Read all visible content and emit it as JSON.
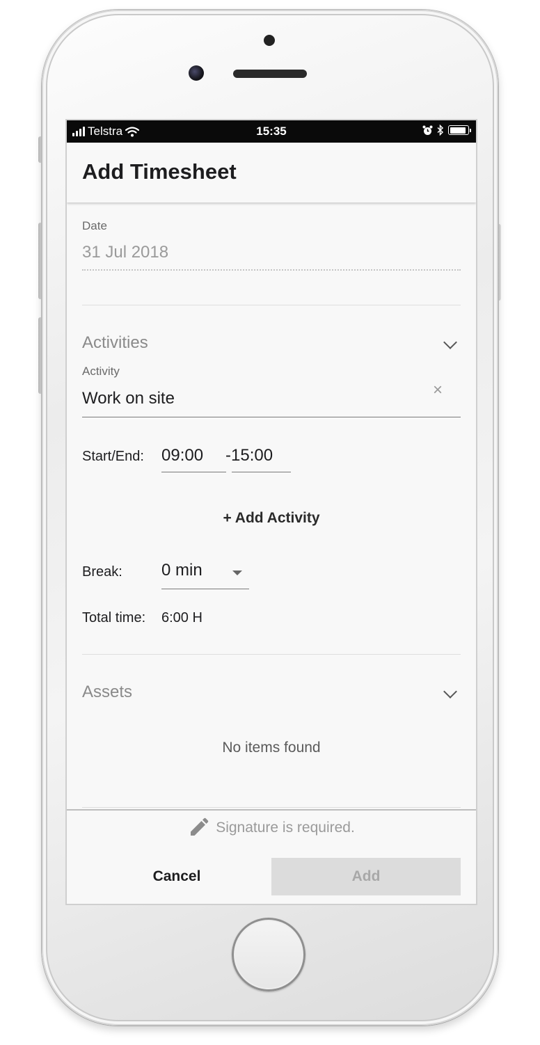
{
  "status_bar": {
    "carrier": "Telstra",
    "time": "15:35",
    "battery_level": 0.9
  },
  "header": {
    "title": "Add Timesheet"
  },
  "date_field": {
    "label": "Date",
    "value": "31 Jul 2018"
  },
  "activities": {
    "title": "Activities",
    "activity_label": "Activity",
    "activity_value": "Work on site",
    "start_end_label": "Start/End:",
    "start_time": "09:00",
    "end_time": "-15:00",
    "add_activity_label": "+ Add Activity",
    "break_label": "Break:",
    "break_value": "0 min",
    "total_time_label": "Total time:",
    "total_time_value": "6:00 H"
  },
  "assets": {
    "title": "Assets",
    "empty_message": "No items found"
  },
  "footer": {
    "signature_message": "Signature is required.",
    "cancel_label": "Cancel",
    "add_label": "Add"
  },
  "icons": {
    "wifi": "wifi-icon",
    "alarm": "alarm-icon",
    "bluetooth": "bluetooth-icon",
    "chevron": "chevron-down-icon",
    "clear": "close-icon",
    "pencil": "pencil-icon"
  },
  "colors": {
    "status_bar_bg": "#0a0a0a",
    "screen_bg": "#f8f8f8",
    "disabled_button_bg": "#dcdcdc",
    "muted_text": "#9a9a9a"
  }
}
